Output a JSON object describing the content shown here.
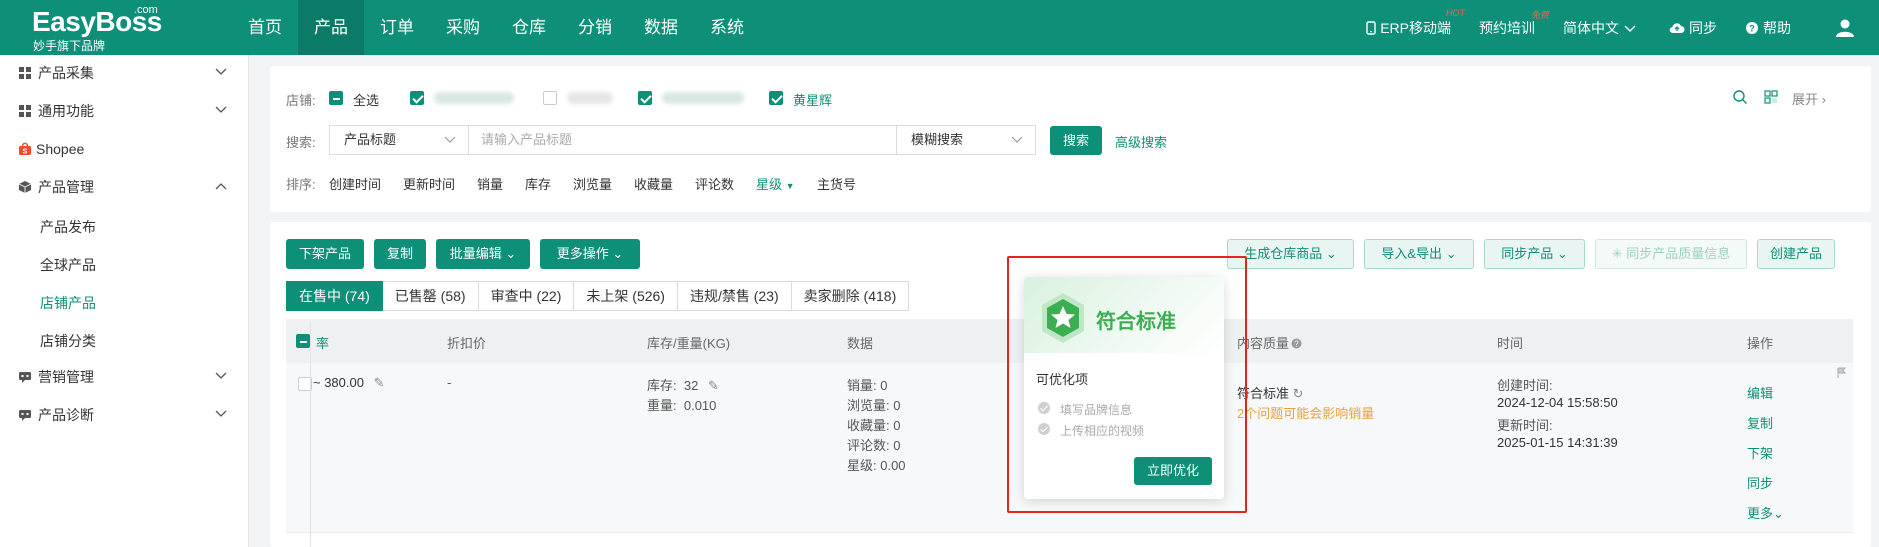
{
  "brand": {
    "name": "EasyBoss",
    "com": ".com",
    "tagline": "妙手旗下品牌"
  },
  "nav": {
    "items": [
      "首页",
      "产品",
      "订单",
      "采购",
      "仓库",
      "分销",
      "数据",
      "系统"
    ],
    "active_index": 1
  },
  "topright": {
    "mobile": "ERP移动端",
    "mobile_badge": "HOT",
    "training": "预约培训",
    "training_badge": "免费",
    "language": "简体中文",
    "sync": "同步",
    "help": "帮助"
  },
  "sidebar": {
    "items": [
      {
        "label": "产品采集",
        "icon": "grid-icon"
      },
      {
        "label": "通用功能",
        "icon": "grid-icon"
      },
      {
        "label": "Shopee",
        "icon": "shopee-icon"
      },
      {
        "label": "产品管理",
        "icon": "box-icon"
      }
    ],
    "sub_items": [
      "产品发布",
      "全球产品",
      "店铺产品",
      "店铺分类"
    ],
    "active_sub_index": 2,
    "bottom_items": [
      {
        "label": "营销管理",
        "icon": "chat-icon"
      },
      {
        "label": "产品诊断",
        "icon": "chat-icon"
      }
    ]
  },
  "filters": {
    "store_label": "店铺:",
    "select_all": "全选",
    "store_named": "黄星辉",
    "search_label": "搜索:",
    "search_field": "产品标题",
    "search_placeholder": "请输入产品标题",
    "search_mode": "模糊搜索",
    "search_button": "搜索",
    "advanced_search": "高级搜索",
    "expand": "展开",
    "sort_label": "排序:",
    "sort_items": [
      "创建时间",
      "更新时间",
      "销量",
      "库存",
      "浏览量",
      "收藏量",
      "评论数",
      "星级",
      "主货号"
    ],
    "sort_highlight_index": 7
  },
  "toolbar": {
    "delist": "下架产品",
    "copy": "复制",
    "batch_edit": "批量编辑",
    "more_ops": "更多操作",
    "gen_warehouse": "生成仓库商品",
    "import_export": "导入&导出",
    "sync_products": "同步产品",
    "sync_quality": "同步产品质量信息",
    "create_product": "创建产品"
  },
  "tabs": [
    "在售中 (74)",
    "已售罄 (58)",
    "审查中 (22)",
    "未上架 (526)",
    "违规/禁售 (23)",
    "卖家删除 (418)"
  ],
  "table": {
    "headers": {
      "rate": "率",
      "discount_price": "折扣价",
      "stock_weight": "库存/重量(KG)",
      "data": "数据",
      "content_quality": "内容质量",
      "time": "时间",
      "ops": "操作"
    },
    "row": {
      "price": "~ 380.00",
      "discount": "-",
      "stock_label": "库存:",
      "stock": "32",
      "weight_label": "重量:",
      "weight": "0.010",
      "data_lines": [
        "销量:  0",
        "浏览量:  0",
        "收藏量:  0",
        "评论数:  0",
        "星级:  0.00"
      ],
      "quality_status": "符合标准",
      "quality_warning": "2个问题可能会影响销量",
      "created_label": "创建时间:",
      "created": "2024-12-04 15:58:50",
      "updated_label": "更新时间:",
      "updated": "2025-01-15 14:31:39",
      "ops": [
        "编辑",
        "复制",
        "下架",
        "同步",
        "更多"
      ]
    }
  },
  "popover": {
    "title": "符合标准",
    "subtitle": "可优化项",
    "items": [
      "填写品牌信息",
      "上传相应的视频"
    ],
    "button": "立即优化"
  },
  "colors": {
    "primary": "#0e8f78",
    "warning": "#e7a23c",
    "success_green": "#3cae52",
    "highlight": "#e5241b"
  }
}
